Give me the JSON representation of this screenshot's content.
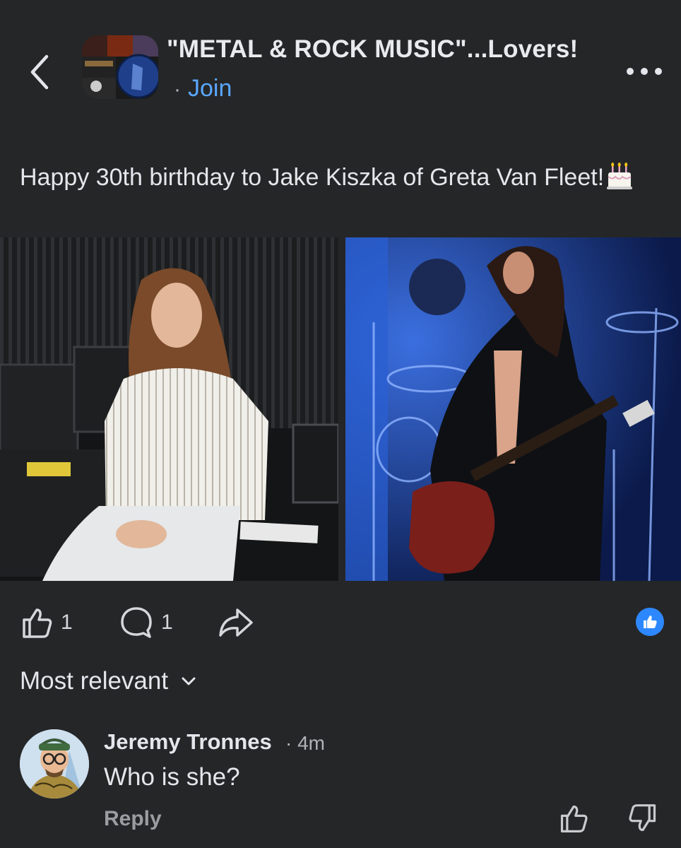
{
  "header": {
    "group_name": "\"METAL & ROCK MUSIC\"...Lovers!",
    "dot": "·",
    "join_label": "Join"
  },
  "post": {
    "text": "Happy 30th birthday to Jake Kiszka of Greta Van Fleet!",
    "emoji_icon": "birthday-cake"
  },
  "actions": {
    "like_count": "1",
    "comment_count": "1",
    "reaction_type": "like"
  },
  "comments": {
    "sort_label": "Most relevant",
    "items": [
      {
        "author": "Jeremy Tronnes",
        "time": "· 4m",
        "text": "Who is she?",
        "reply_label": "Reply"
      }
    ]
  },
  "colors": {
    "background": "#252628",
    "accent_link": "#5aa7ff",
    "reaction_blue": "#2d88ff",
    "text_primary": "#e4e6eb",
    "text_secondary": "#b0b3b8"
  }
}
